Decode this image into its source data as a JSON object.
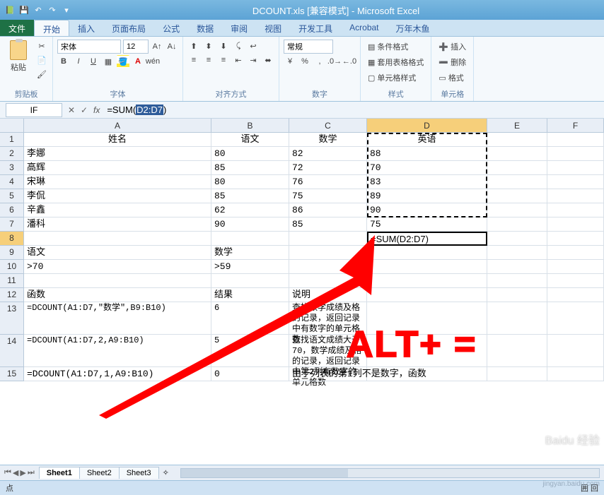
{
  "title": "DCOUNT.xls [兼容模式] - Microsoft Excel",
  "tabs": {
    "file": "文件",
    "home": "开始",
    "insert": "插入",
    "layout": "页面布局",
    "formulas": "公式",
    "data": "数据",
    "review": "审阅",
    "view": "视图",
    "dev": "开发工具",
    "acrobat": "Acrobat",
    "custom": "万年木鱼"
  },
  "ribbon": {
    "paste": "粘贴",
    "clipboard_label": "剪贴板",
    "font_name": "宋体",
    "font_size": "12",
    "font_label": "字体",
    "align_label": "对齐方式",
    "number_format": "常规",
    "number_label": "数字",
    "cond_fmt": "条件格式",
    "table_fmt": "套用表格格式",
    "cell_style": "单元格样式",
    "styles_label": "样式",
    "ins": "插入",
    "del": "删除",
    "fmt": "格式",
    "cells_label": "单元格"
  },
  "fbar": {
    "name": "IF",
    "formula_pre": "=SUM(",
    "formula_sel": "D2:D7",
    "formula_post": ")"
  },
  "cols": [
    "A",
    "B",
    "C",
    "D",
    "E",
    "F"
  ],
  "rows": {
    "1": {
      "A": "姓名",
      "B": "语文",
      "C": "数学",
      "D": "英语"
    },
    "2": {
      "A": "李娜",
      "B": "80",
      "C": "82",
      "D": "88"
    },
    "3": {
      "A": "高辉",
      "B": "85",
      "C": "72",
      "D": "70"
    },
    "4": {
      "A": "宋琳",
      "B": "80",
      "C": "76",
      "D": "83"
    },
    "5": {
      "A": "李侃",
      "B": "85",
      "C": "75",
      "D": "89"
    },
    "6": {
      "A": "辛鑫",
      "B": "62",
      "C": "86",
      "D": "90"
    },
    "7": {
      "A": "潘科",
      "B": "90",
      "C": "85",
      "D": "75"
    },
    "8": {
      "D": "=SUM(D2:D7)"
    },
    "9": {
      "A": "语文",
      "B": "数学"
    },
    "10": {
      "A": ">70",
      "B": ">59"
    },
    "12": {
      "A": "函数",
      "B": "结果",
      "C": "说明"
    },
    "13": {
      "A": "=DCOUNT(A1:D7,\"数学\",B9:B10)",
      "B": "6",
      "C": "查找数学成绩及格的记录，返回记录中有数字的单元格数"
    },
    "14": {
      "A": "=DCOUNT(A1:D7,2,A9:B10)",
      "B": "5",
      "C": "查找语文成绩大于70，数学成绩及格的记录，返回记录中第2列有数字的单元格数"
    },
    "15": {
      "A": "=DCOUNT(A1:D7,1,A9:B10)",
      "B": "0",
      "C": "由于列表的第1列不是数字，函数"
    }
  },
  "sheets": [
    "Sheet1",
    "Sheet2",
    "Sheet3"
  ],
  "status": {
    "left": "点",
    "right": "囲 回"
  },
  "annotation": {
    "text": "ALT+ =",
    "watermark": "Baidu 经验",
    "watermark2": "jingyan.baidu.com"
  }
}
